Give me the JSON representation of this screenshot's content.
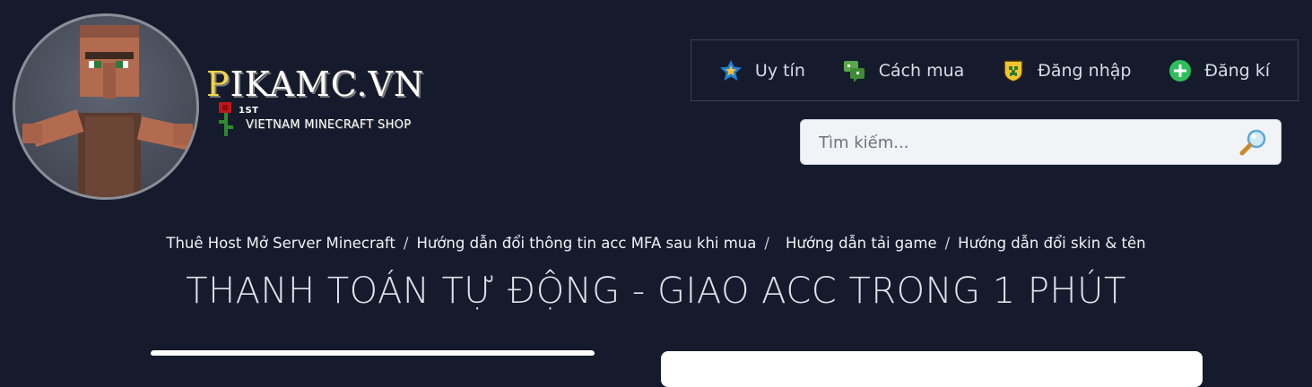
{
  "brand": {
    "title_rest": "IKAMC.VN",
    "title_first": "P",
    "badge": "1ST",
    "subtitle": "VIETNAM MINECRAFT SHOP",
    "avatar_icon": "villager-avatar-icon"
  },
  "topnav": {
    "items": [
      {
        "label": "Uy tín",
        "icon": "star-badge-icon"
      },
      {
        "label": "Cách mua",
        "icon": "chat-bubble-icon"
      },
      {
        "label": "Đăng nhập",
        "icon": "creeper-shield-icon"
      },
      {
        "label": "Đăng kí",
        "icon": "plus-circle-icon"
      }
    ]
  },
  "search": {
    "placeholder": "Tìm kiếm...",
    "value": "",
    "icon": "magnifier-icon"
  },
  "breadcrumb": {
    "links": [
      "Thuê Host Mở Server Minecraft",
      "Hướng dẫn đổi thông tin acc MFA sau khi mua",
      "Hướng dẫn tải game",
      "Hướng dẫn đổi skin & tên"
    ],
    "separator": "/"
  },
  "headline": "THANH TOÁN TỰ ĐỘNG - GIAO ACC TRONG 1 PHÚT",
  "colors": {
    "background": "#151b2c",
    "nav_border": "#3a4152",
    "brand_gold": "#f2d64b",
    "plus_green": "#2fbf5a"
  }
}
